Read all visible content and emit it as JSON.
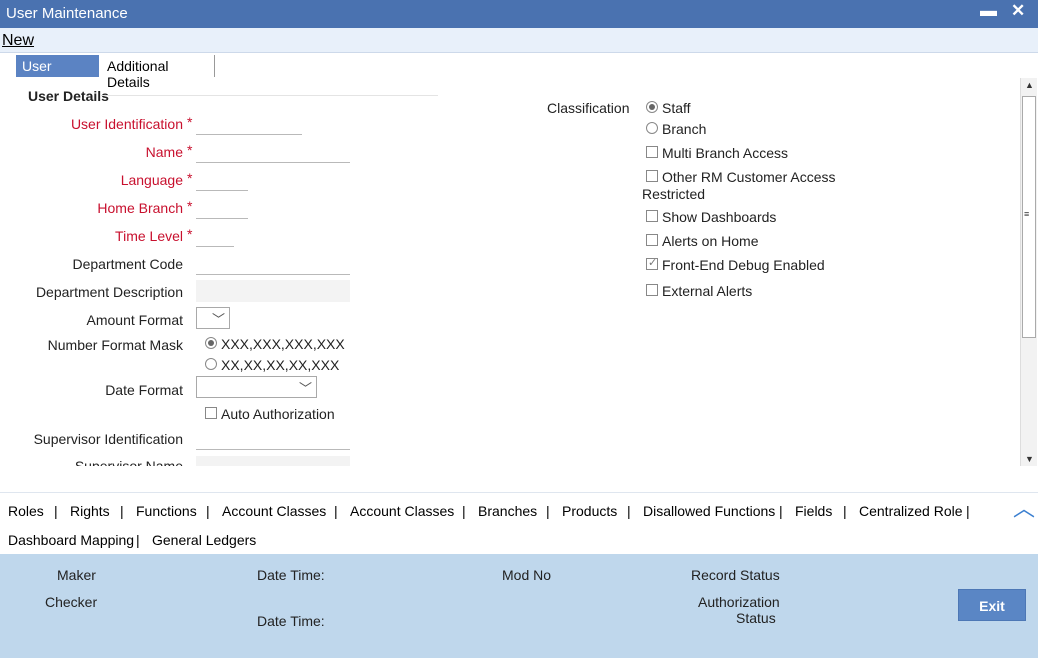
{
  "window": {
    "title": "User Maintenance",
    "minimize_glyph": "▬",
    "close_glyph": "✕"
  },
  "menu": {
    "new_label": "New"
  },
  "tabs": [
    {
      "label": "User Details"
    },
    {
      "label": "Additional Details"
    }
  ],
  "user_details": {
    "section_title": "User Details",
    "required_marker": "*",
    "labels": {
      "user_identification": "User Identification",
      "name": "Name",
      "language": "Language",
      "home_branch": "Home Branch",
      "time_level": "Time Level",
      "department_code": "Department Code",
      "department_description": "Department Description",
      "amount_format": "Amount Format",
      "number_format_mask": "Number Format Mask",
      "date_format": "Date Format",
      "supervisor_identification": "Supervisor Identification",
      "supervisor_name": "Supervisor Name"
    },
    "number_format_options": [
      {
        "label": "XXX,XXX,XXX,XXX",
        "selected": true
      },
      {
        "label": "XX,XX,XX,XX,XXX",
        "selected": false
      }
    ],
    "auto_authorization": {
      "label": "Auto Authorization",
      "checked": false
    }
  },
  "classification": {
    "label": "Classification",
    "options": [
      {
        "label": "Staff",
        "selected": true
      },
      {
        "label": "Branch",
        "selected": false
      }
    ],
    "checks": {
      "multi_branch": {
        "label": "Multi Branch Access",
        "checked": false
      },
      "other_rm_line1": "Other RM Customer Access",
      "other_rm_line2": "Restricted",
      "show_dashboards": {
        "label": "Show Dashboards",
        "checked": false
      },
      "alerts_on_home": {
        "label": "Alerts on Home",
        "checked": false
      },
      "front_end_debug": {
        "label": "Front-End Debug Enabled",
        "checked": true
      },
      "external_alerts": {
        "label": "External Alerts",
        "checked": false
      }
    }
  },
  "subsystems": {
    "separator": "|",
    "row1": [
      "Roles",
      "Rights",
      "Functions",
      "Account Classes",
      "Account Classes",
      "Branches",
      "Products",
      "Disallowed Functions",
      "Fields",
      "Centralized Role"
    ],
    "row2": [
      "Dashboard Mapping",
      "General Ledgers"
    ]
  },
  "footer": {
    "maker": "Maker",
    "checker": "Checker",
    "date_time": "Date Time:",
    "mod_no": "Mod No",
    "record_status": "Record Status",
    "authorization_line1": "Authorization",
    "authorization_line2": "Status",
    "exit_label": "Exit"
  },
  "icons": {
    "dropdown": "chevron-down-icon",
    "collapse": "chevron-up-icon"
  },
  "colors": {
    "title_bar": "#4a72b0",
    "required": "#c8102e",
    "footer": "#bfd7ec",
    "button": "#5a86c5"
  }
}
